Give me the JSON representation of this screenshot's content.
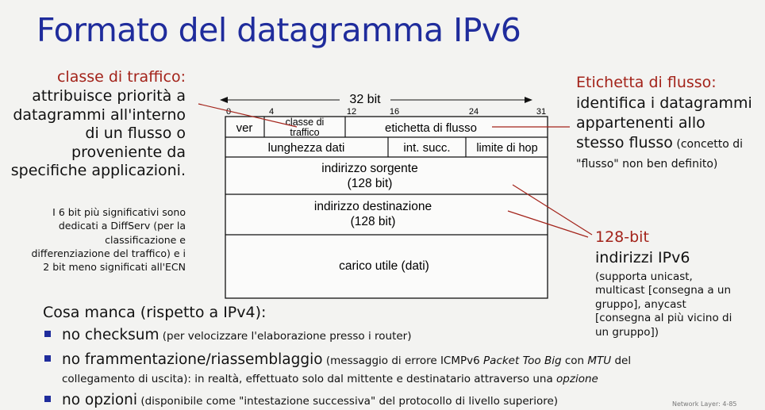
{
  "title": "Formato del datagramma IPv6",
  "left_annotation": {
    "heading": "classe di traffico:",
    "lines": [
      "attribuisce priorità a",
      "datagrammi all'interno",
      "di un flusso o",
      "proveniente da",
      "specifiche applicazioni."
    ],
    "note_lines": [
      "I 6 bit più significativi sono",
      "dedicati a DiffServ (per la",
      "classificazione e",
      "differenziazione del traffico) e i",
      "2 bit meno significati all'ECN"
    ]
  },
  "right_annotation": {
    "heading": "Etichetta di flusso:",
    "line1": "identifica i datagrammi",
    "line2": "appartenenti allo",
    "line3a": "stesso flusso",
    "line3b": " (concetto di",
    "line4": "\"flusso\" non ben definito)"
  },
  "addr_annotation": {
    "heading": "128-bit",
    "subheading": "indirizzi IPv6",
    "note_lines": [
      "(supporta unicast,",
      "multicast [consegna a un",
      "gruppo], anycast",
      "[consegna al più vicino di",
      "un gruppo])"
    ]
  },
  "diagram": {
    "width_label": "32 bit",
    "bit_ticks": [
      "0",
      "4",
      "12",
      "16",
      "24",
      "31"
    ],
    "fields": {
      "ver": "ver",
      "traffic_class_1": "classe di",
      "traffic_class_2": "traffico",
      "flow_label": "etichetta di flusso",
      "payload_length": "lunghezza dati",
      "next_header": "int. succ.",
      "hop_limit": "limite di hop",
      "src_1": "indirizzo sorgente",
      "src_2": "(128 bit)",
      "dst_1": "indirizzo destinazione",
      "dst_2": "(128 bit)",
      "payload": "carico utile (dati)"
    }
  },
  "bottom": {
    "heading": "Cosa manca (rispetto a IPv4):",
    "b1_main": "no checksum",
    "b1_rest": " (per velocizzare l'elaborazione presso i router)",
    "b2_main": "no frammentazione/riassemblaggio",
    "b2_rest_1": " (messaggio di errore ICMPv6 ",
    "b2_italic_1": "Packet Too Big",
    "b2_rest_2": " con ",
    "b2_italic_2": "MTU",
    "b2_rest_3": " del",
    "b2_cont": "collegamento di uscita): in realtà, effettuato solo dal mittente e destinatario attraverso una ",
    "b2_cont_italic": "opzione",
    "b3_main": "no opzioni",
    "b3_rest": " (disponibile come \"intestazione successiva\" del protocollo di livello superiore)"
  },
  "footer": "Network Layer: 4-85",
  "colors": {
    "title": "#1f2c9c",
    "accent_red": "#a3231a",
    "bullet": "#1f2c9c"
  }
}
